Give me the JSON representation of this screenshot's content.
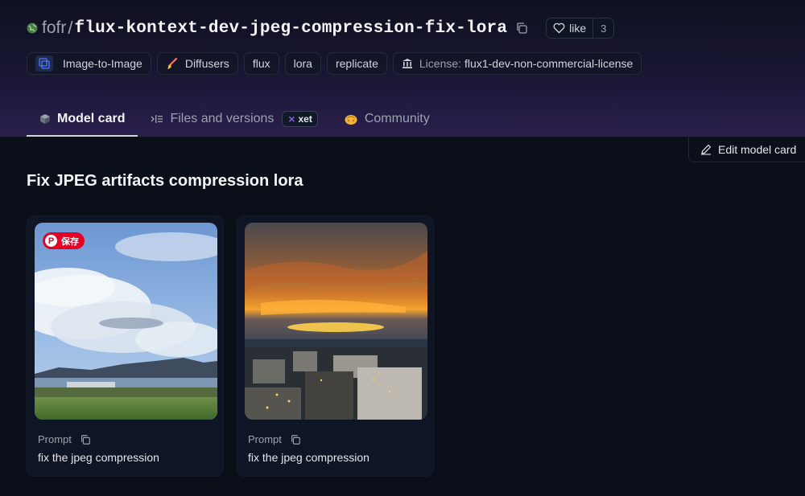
{
  "repo": {
    "owner": "fofr",
    "separator": "/",
    "name": "flux-kontext-dev-jpeg-compression-fix-lora",
    "like_label": "like",
    "like_count": "3"
  },
  "tags": [
    {
      "label": "Image-to-Image",
      "icon": "image-to-image-icon"
    },
    {
      "label": "Diffusers",
      "icon": "diffusers-brush-icon"
    },
    {
      "label": "flux"
    },
    {
      "label": "lora"
    },
    {
      "label": "replicate"
    }
  ],
  "license": {
    "key": "License:",
    "value": "flux1-dev-non-commercial-license",
    "icon": "bank-icon"
  },
  "tabs": [
    {
      "label": "Model card",
      "icon": "cube-icon",
      "active": true
    },
    {
      "label": "Files and versions",
      "icon": "file-list-icon",
      "badge": "xet"
    },
    {
      "label": "Community",
      "icon": "community-hand-icon"
    }
  ],
  "edit_button": "Edit model card",
  "heading": "Fix JPEG artifacts compression lora",
  "gallery": [
    {
      "pin_label": "保存",
      "prompt_label": "Prompt",
      "prompt": "fix the jpeg compression"
    },
    {
      "prompt_label": "Prompt",
      "prompt": "fix the jpeg compression"
    }
  ],
  "colors": {
    "background": "#0b0f19",
    "header_gradient_end": "#2a1f4d",
    "pinterest_red": "#e60023",
    "xet_accent": "#8b5cf6"
  }
}
